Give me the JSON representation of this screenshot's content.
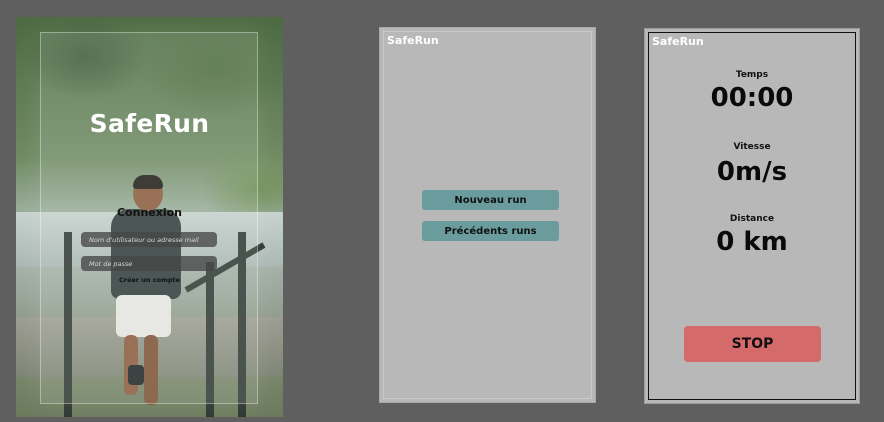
{
  "colors": {
    "page_background": "#5f5f5f",
    "screen_background": "#b8b8b8",
    "menu_button": "#6a9c9e",
    "stop_button": "#d46a6a",
    "brand_text": "#ffffff"
  },
  "login": {
    "logo": "SafeRun",
    "heading": "Connexion",
    "username_placeholder": "Nom d'utilisateur ou adresse mail",
    "password_placeholder": "Mot de passe",
    "create_account": "Créer un compte"
  },
  "menu": {
    "brand": "SafeRun",
    "new_run": "Nouveau run",
    "previous_runs": "Précédents runs"
  },
  "run": {
    "brand": "SafeRun",
    "time_label": "Temps",
    "time_value": "00:00",
    "speed_label": "Vitesse",
    "speed_value": "0m/s",
    "distance_label": "Distance",
    "distance_value": "0 km",
    "stop": "STOP"
  }
}
